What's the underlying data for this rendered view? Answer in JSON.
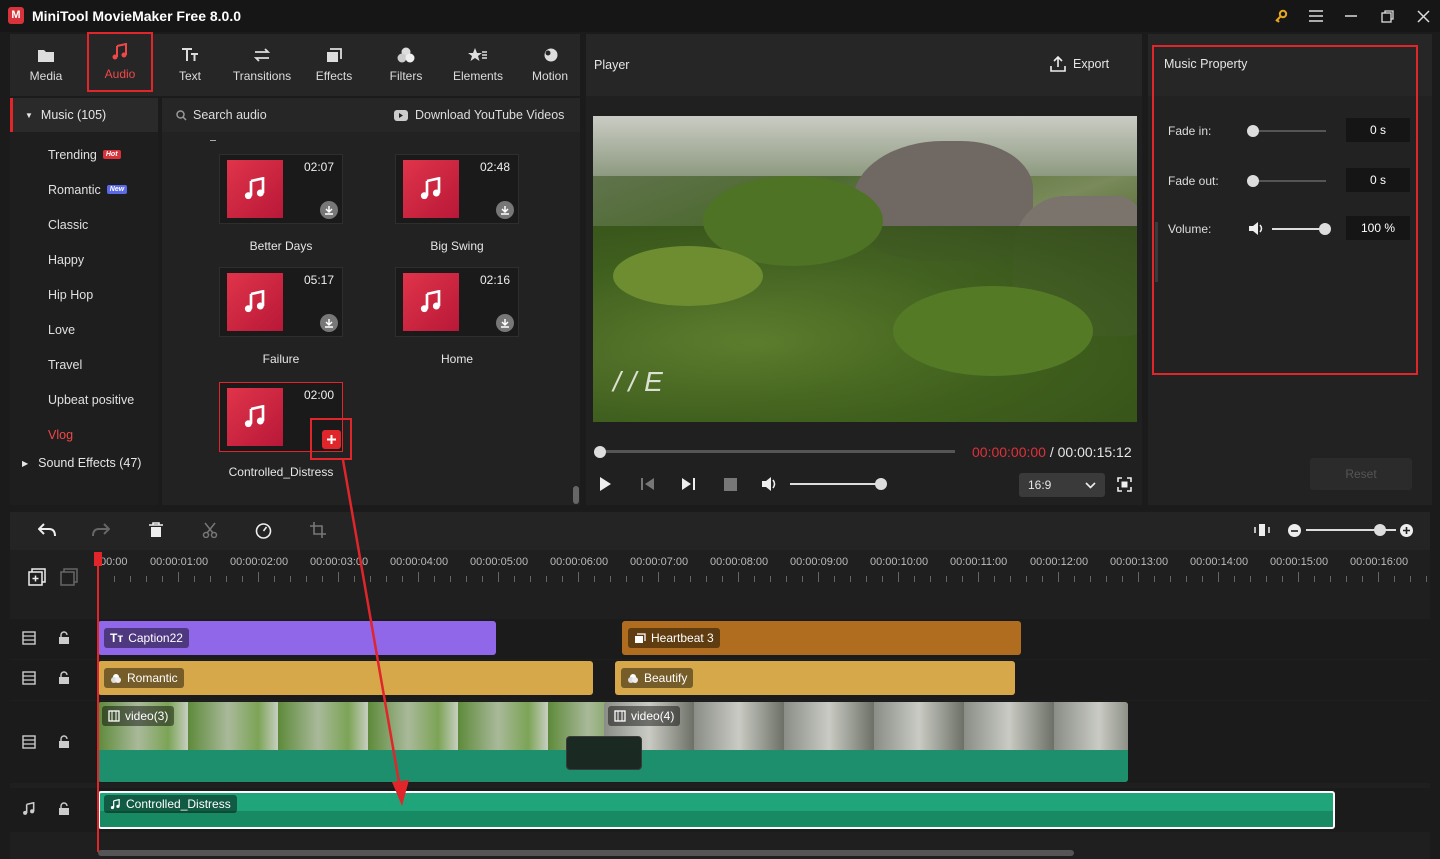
{
  "app": {
    "title": "MiniTool MovieMaker Free 8.0.0",
    "logo_letter": "M"
  },
  "toolbar": {
    "tabs": [
      {
        "label": "Media",
        "icon": "folder-icon"
      },
      {
        "label": "Audio",
        "icon": "music-note-icon",
        "active": true
      },
      {
        "label": "Text",
        "icon": "text-icon"
      },
      {
        "label": "Transitions",
        "icon": "swap-arrows-icon"
      },
      {
        "label": "Effects",
        "icon": "layers-icon"
      },
      {
        "label": "Filters",
        "icon": "filters-icon"
      },
      {
        "label": "Elements",
        "icon": "star-icon"
      },
      {
        "label": "Motion",
        "icon": "motion-icon"
      }
    ]
  },
  "sidebar": {
    "music_header": "Music (105)",
    "items": [
      {
        "label": "Trending",
        "badge": "Hot"
      },
      {
        "label": "Romantic",
        "badge": "New"
      },
      {
        "label": "Classic"
      },
      {
        "label": "Happy"
      },
      {
        "label": "Hip Hop"
      },
      {
        "label": "Love"
      },
      {
        "label": "Travel"
      },
      {
        "label": "Upbeat positive"
      },
      {
        "label": "Vlog",
        "active": true
      }
    ],
    "sound_effects": "Sound Effects (47)"
  },
  "library": {
    "search_placeholder": "Search audio",
    "download_label": "Download YouTube Videos",
    "tracks": [
      {
        "name": "Better Days",
        "duration": "02:07"
      },
      {
        "name": "Big Swing",
        "duration": "02:48"
      },
      {
        "name": "Failure",
        "duration": "05:17"
      },
      {
        "name": "Home",
        "duration": "02:16"
      },
      {
        "name": "Controlled_Distress",
        "duration": "02:00"
      }
    ]
  },
  "player": {
    "title": "Player",
    "export_label": "Export",
    "current_time": "00:00:00:00",
    "separator": " / ",
    "total_time": "00:00:15:12",
    "aspect": "16:9",
    "volume_fraction": 0.97
  },
  "properties": {
    "title": "Music Property",
    "fade_in_label": "Fade in:",
    "fade_in_value": "0 s",
    "fade_out_label": "Fade out:",
    "fade_out_value": "0 s",
    "volume_label": "Volume:",
    "volume_value": "100 %",
    "reset_label": "Reset"
  },
  "timeline": {
    "ticks": [
      "00:00",
      "00:00:01:00",
      "00:00:02:00",
      "00:00:03:00",
      "00:00:04:00",
      "00:00:05:00",
      "00:00:06:00",
      "00:00:07:00",
      "00:00:08:00",
      "00:00:09:00",
      "00:00:10:00",
      "00:00:11:00",
      "00:00:12:00",
      "00:00:13:00",
      "00:00:14:00",
      "00:00:15:00",
      "00:00:16:00"
    ],
    "clips": {
      "caption": "Caption22",
      "heartbeat": "Heartbeat 3",
      "romantic": "Romantic",
      "beautify": "Beautify",
      "video3": "video(3)",
      "video4": "video(4)",
      "audio": "Controlled_Distress"
    },
    "zoom_fraction": 0.82
  },
  "colors": {
    "accent": "#e0252b",
    "caption": "#8f67e8",
    "heartbeat": "#b06d1f",
    "filter": "#d6a84a",
    "audio": "#20a57a"
  }
}
